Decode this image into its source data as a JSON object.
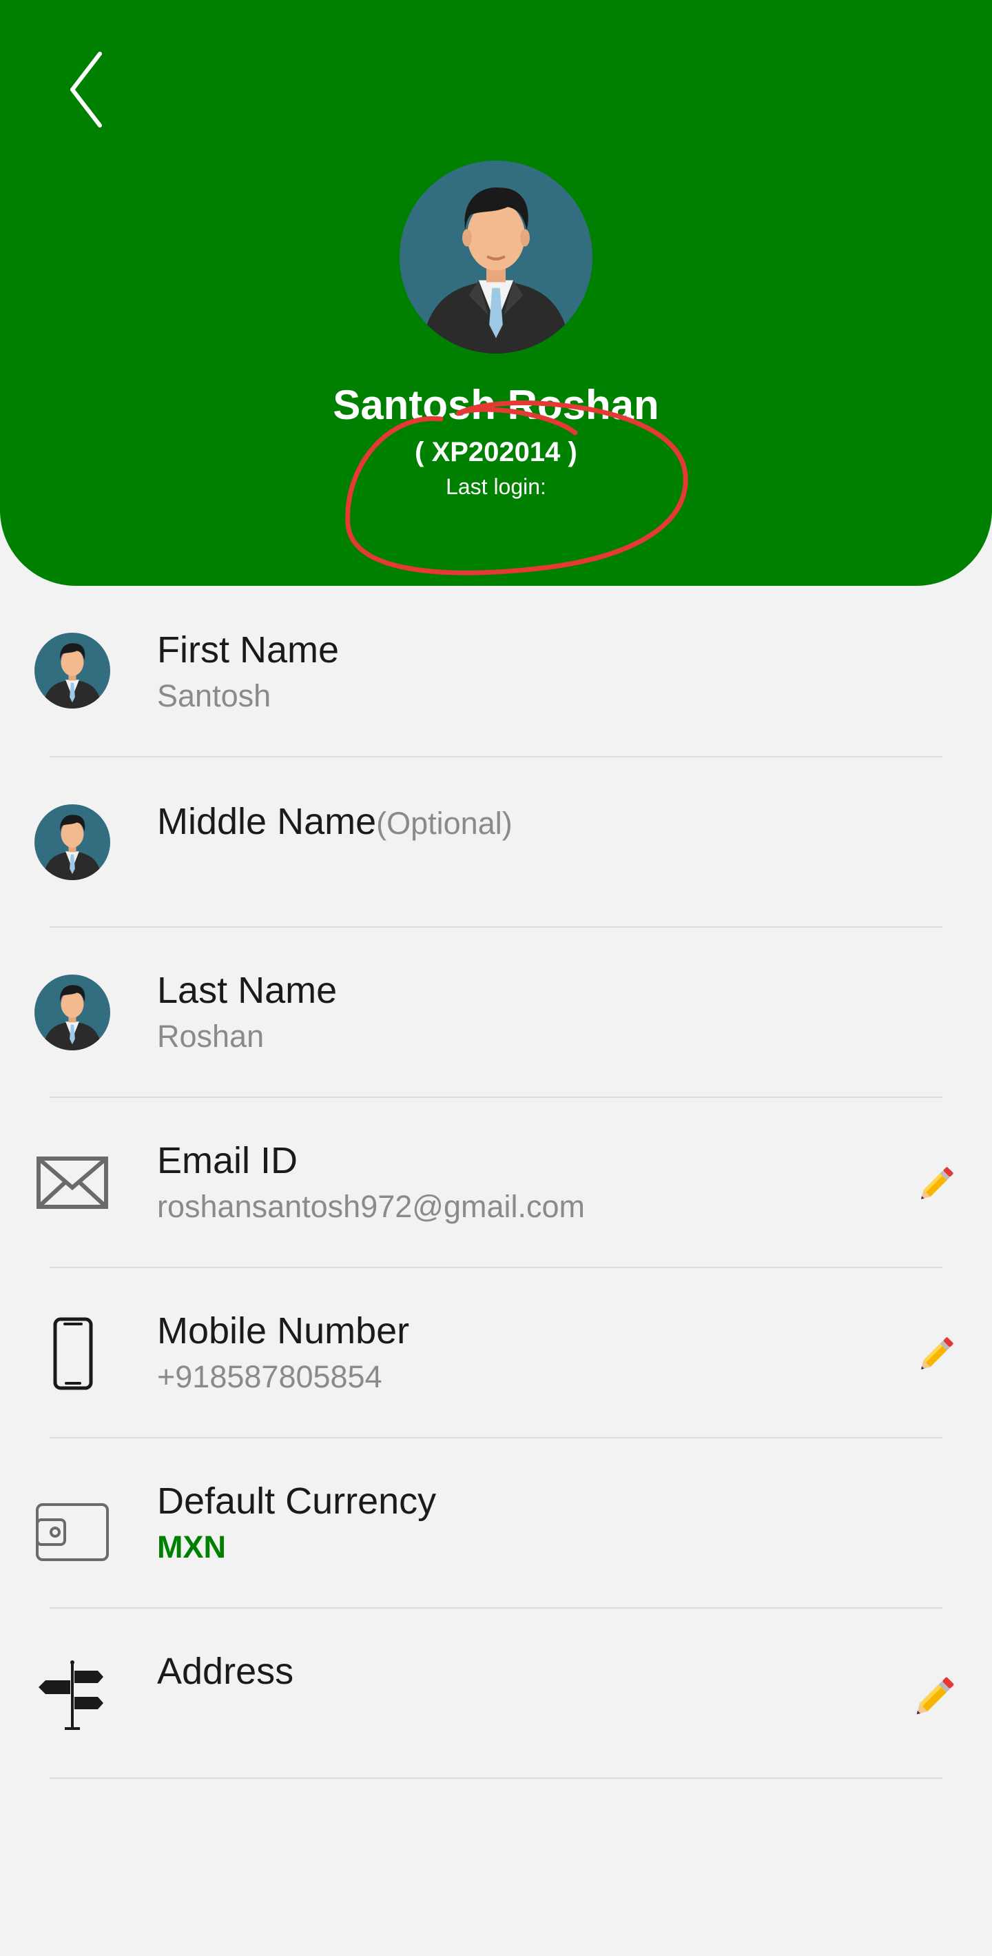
{
  "header": {
    "name": "Santosh Roshan",
    "user_id": "( XP202014 )",
    "last_login_label": "Last login:",
    "background_color": "#008000"
  },
  "fields": {
    "first_name": {
      "label": "First Name",
      "value": "Santosh",
      "icon": "person-avatar-icon"
    },
    "middle_name": {
      "label": "Middle Name",
      "optional": "(Optional)",
      "value": "",
      "icon": "person-avatar-icon"
    },
    "last_name": {
      "label": "Last Name",
      "value": "Roshan",
      "icon": "person-avatar-icon"
    },
    "email": {
      "label": "Email ID",
      "value": "roshansantosh972@gmail.com",
      "icon": "envelope-icon",
      "editable": true
    },
    "mobile": {
      "label": "Mobile Number",
      "value": "+918587805854",
      "icon": "phone-icon",
      "editable": true
    },
    "currency": {
      "label": "Default Currency",
      "value": "MXN",
      "icon": "wallet-icon"
    },
    "address": {
      "label": "Address",
      "value": "",
      "icon": "signpost-icon",
      "editable": true
    }
  },
  "colors": {
    "accent": "#008000",
    "annotation": "#e53935"
  }
}
